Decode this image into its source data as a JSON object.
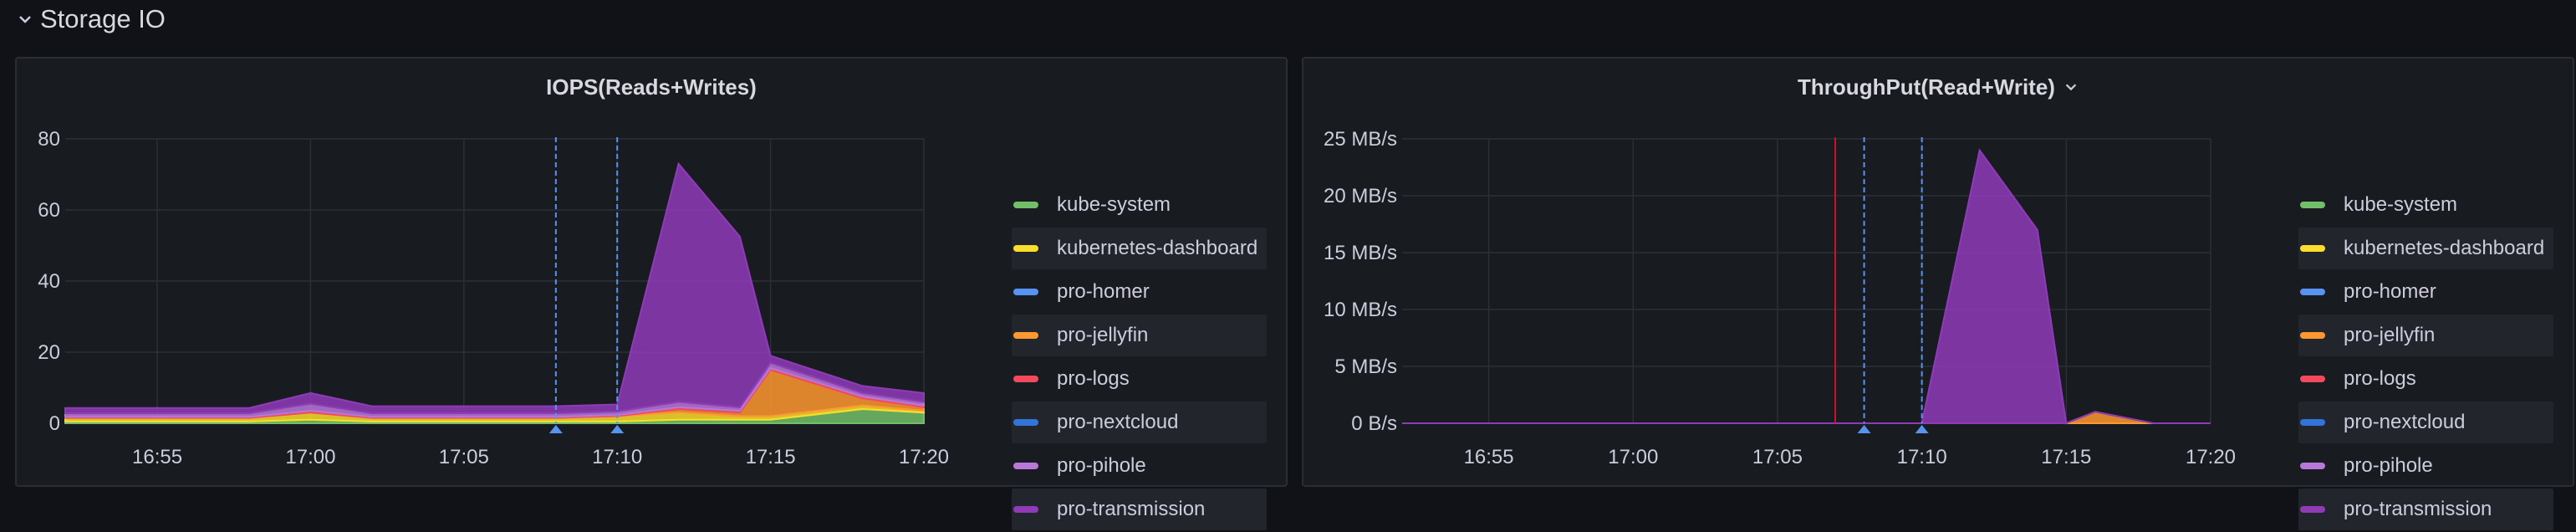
{
  "row": {
    "title": "Storage IO"
  },
  "legend_items": [
    {
      "label": "kube-system",
      "color": "#73bf69"
    },
    {
      "label": "kubernetes-dashboard",
      "color": "#fade2a"
    },
    {
      "label": "pro-homer",
      "color": "#5794f2"
    },
    {
      "label": "pro-jellyfin",
      "color": "#ff9830"
    },
    {
      "label": "pro-logs",
      "color": "#f2495c"
    },
    {
      "label": "pro-nextcloud",
      "color": "#3274d9"
    },
    {
      "label": "pro-pihole",
      "color": "#b877d9"
    },
    {
      "label": "pro-transmission",
      "color": "#8f3bb8"
    }
  ],
  "panels": [
    {
      "title": "IOPS(Reads+Writes)",
      "has_menu": false,
      "y_ticks": [
        "0",
        "20",
        "40",
        "60",
        "80"
      ],
      "x_ticks": [
        "16:55",
        "17:00",
        "17:05",
        "17:10",
        "17:15",
        "17:20"
      ]
    },
    {
      "title": "ThroughPut(Read+Write)",
      "has_menu": true,
      "y_ticks": [
        "0 B/s",
        "5 MB/s",
        "10 MB/s",
        "15 MB/s",
        "20 MB/s",
        "25 MB/s"
      ],
      "x_ticks": [
        "16:55",
        "17:00",
        "17:05",
        "17:10",
        "17:15",
        "17:20"
      ]
    }
  ],
  "chart_data": [
    {
      "type": "area",
      "title": "IOPS(Reads+Writes)",
      "stacked": true,
      "x": [
        "16:52",
        "16:58",
        "17:00",
        "17:02",
        "17:08",
        "17:10",
        "17:12",
        "17:14",
        "17:15",
        "17:18",
        "17:20"
      ],
      "ylim": [
        0,
        80
      ],
      "series": [
        {
          "name": "kube-system",
          "values": [
            0.5,
            0.5,
            1,
            0.5,
            0.5,
            0.5,
            1,
            1,
            1,
            4,
            3
          ]
        },
        {
          "name": "kubernetes-dashboard",
          "values": [
            1,
            1,
            2,
            1,
            1,
            1.5,
            2,
            1,
            1,
            1,
            0.5
          ]
        },
        {
          "name": "pro-homer",
          "values": [
            0,
            0,
            0,
            0,
            0,
            0,
            0,
            0,
            0,
            0,
            0
          ]
        },
        {
          "name": "pro-jellyfin",
          "values": [
            0,
            0,
            0,
            0,
            0,
            0,
            1,
            1,
            13,
            2,
            1
          ]
        },
        {
          "name": "pro-logs",
          "values": [
            0.3,
            0.3,
            0.5,
            0.3,
            0.3,
            0.3,
            0.5,
            0.5,
            0.5,
            0.5,
            0.5
          ]
        },
        {
          "name": "pro-nextcloud",
          "values": [
            0,
            0,
            0,
            0,
            0,
            0,
            0,
            0,
            0,
            0,
            0
          ]
        },
        {
          "name": "pro-pihole",
          "values": [
            1,
            1,
            2,
            1,
            1,
            1,
            1.5,
            1,
            1.5,
            1,
            1
          ]
        },
        {
          "name": "pro-transmission",
          "values": [
            1.5,
            1.5,
            3,
            2,
            2,
            2,
            67,
            48,
            2,
            2,
            2.5
          ]
        }
      ],
      "annotations": [
        "17:08",
        "17:10"
      ]
    },
    {
      "type": "area",
      "title": "ThroughPut(Read+Write)",
      "stacked": true,
      "x": [
        "16:52",
        "17:09.5",
        "17:10",
        "17:12",
        "17:14",
        "17:15",
        "17:16",
        "17:18",
        "17:20"
      ],
      "ylim": [
        0,
        25
      ],
      "series": [
        {
          "name": "pro-jellyfin",
          "values": [
            0,
            0,
            0,
            0,
            0,
            0,
            1,
            0,
            0
          ]
        },
        {
          "name": "pro-transmission",
          "values": [
            0,
            0,
            0,
            24,
            17,
            0,
            0,
            0,
            0
          ]
        }
      ],
      "annotations": [
        "17:08",
        "17:10"
      ],
      "threshold_line": "17:07"
    }
  ]
}
